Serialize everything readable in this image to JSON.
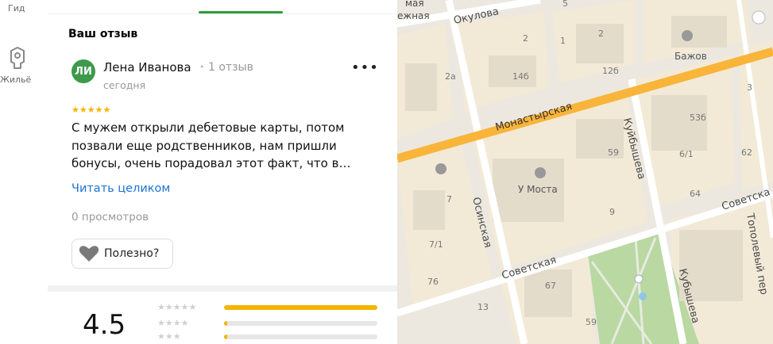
{
  "rail": {
    "guide_label": "Гид",
    "housing_label": "Жильё"
  },
  "review_section": {
    "title": "Ваш отзыв",
    "user": {
      "initials": "ЛИ",
      "name": "Лена Иванова",
      "reviews_count": "1 отзыв",
      "date": "сегодня"
    },
    "stars": "★★★★★",
    "rating": 5,
    "text": "С мужем открыли дебетовые карты, потом позвали еще родственников, нам пришли бонусы, очень порадовал этот факт, что в…",
    "read_more": "Читать целиком",
    "views": "0 просмотров",
    "useful_label": "Полезно?"
  },
  "rating_summary": {
    "overall": "4.5",
    "rows": [
      {
        "stars": "★★★★★",
        "fill": 1.0
      },
      {
        "stars": "★★★★",
        "fill": 0.02
      },
      {
        "stars": "★★★",
        "fill": 0.02
      }
    ]
  },
  "map": {
    "streets": [
      "Окулова",
      "Монастырская",
      "Куйбышева",
      "Осинская",
      "Советская",
      "Советска",
      "Тополевый пер",
      "Кубышева",
      "ежная",
      "мая"
    ],
    "places": [
      "Бажов",
      "У Моста"
    ],
    "house_numbers": [
      "5",
      "1",
      "2",
      "2",
      "3",
      "2а",
      "14б",
      "12б",
      "53б",
      "59",
      "6/1",
      "62",
      "7",
      "64",
      "9",
      "7/1",
      "76",
      "67",
      "13",
      "59"
    ],
    "colors": {
      "road_orange": "#f9b43a",
      "block": "#f2ead7",
      "building": "#e4dccb",
      "park": "#b9d8a2"
    }
  }
}
